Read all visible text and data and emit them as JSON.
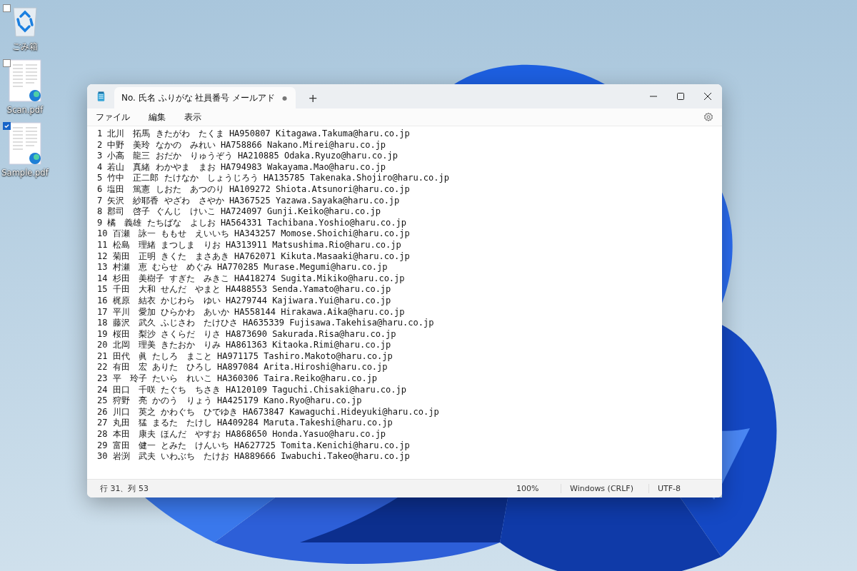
{
  "desktop_icons": [
    {
      "kind": "recycle",
      "label": "ごみ箱",
      "selected": false
    },
    {
      "kind": "pdf",
      "label": "Scan.pdf",
      "selected": false
    },
    {
      "kind": "pdf",
      "label": "Sample.pdf",
      "selected": true
    }
  ],
  "window": {
    "tabs": [
      {
        "label": "No. 氏名 ふりがな 社員番号 メールアド",
        "unsaved_mark": "●",
        "selected": true
      }
    ],
    "new_tab": "+",
    "menu": [
      "ファイル",
      "編集",
      "表示"
    ],
    "lines": [
      "1 北川　拓馬 きたがわ　たくま HA950807 Kitagawa.Takuma@haru.co.jp",
      "2 中野　美玲 なかの　みれい HA758866 Nakano.Mirei@haru.co.jp",
      "3 小高　龍三 おだか　りゅうぞう HA210885 Odaka.Ryuzo@haru.co.jp",
      "4 若山　真緒 わかやま　まお HA794983 Wakayama.Mao@haru.co.jp",
      "5 竹中　正二郎 たけなか　しょうじろう HA135785 Takenaka.Shojiro@haru.co.jp",
      "6 塩田　篤憲 しおた　あつのり HA109272 Shiota.Atsunori@haru.co.jp",
      "7 矢沢　紗耶香 やざわ　さやか HA367525 Yazawa.Sayaka@haru.co.jp",
      "8 郡司　啓子 ぐんじ　けいこ HA724097 Gunji.Keiko@haru.co.jp",
      "9 橘　義雄 たちばな　よしお HA564331 Tachibana.Yoshio@haru.co.jp",
      "10 百瀬　詠一 ももせ　えいいち HA343257 Momose.Shoichi@haru.co.jp",
      "11 松島　理緒 まつしま　りお HA313911 Matsushima.Rio@haru.co.jp",
      "12 菊田　正明 きくた　まさあき HA762071 Kikuta.Masaaki@haru.co.jp",
      "13 村瀬　恵 むらせ　めぐみ HA770285 Murase.Megumi@haru.co.jp",
      "14 杉田　美樹子 すぎた　みきこ HA418274 Sugita.Mikiko@haru.co.jp",
      "15 千田　大和 せんだ　やまと HA488553 Senda.Yamato@haru.co.jp",
      "16 梶原　結衣 かじわら　ゆい HA279744 Kajiwara.Yui@haru.co.jp",
      "17 平川　愛加 ひらかわ　あいか HA558144 Hirakawa.Aika@haru.co.jp",
      "18 藤沢　武久 ふじさわ　たけひさ HA635339 Fujisawa.Takehisa@haru.co.jp",
      "19 桜田　梨沙 さくらだ　りさ HA873690 Sakurada.Risa@haru.co.jp",
      "20 北岡　理美 きたおか　りみ HA861363 Kitaoka.Rimi@haru.co.jp",
      "21 田代　眞 たしろ　まこと HA971175 Tashiro.Makoto@haru.co.jp",
      "22 有田　宏 ありた　ひろし HA897084 Arita.Hiroshi@haru.co.jp",
      "23 平　玲子 たいら　れいこ HA360306 Taira.Reiko@haru.co.jp",
      "24 田口　千咲 たぐち　ちさき HA120109 Taguchi.Chisaki@haru.co.jp",
      "25 狩野　亮 かのう　りょう HA425179 Kano.Ryo@haru.co.jp",
      "26 川口　英之 かわぐち　ひでゆき HA673847 Kawaguchi.Hideyuki@haru.co.jp",
      "27 丸田　猛 まるた　たけし HA409284 Maruta.Takeshi@haru.co.jp",
      "28 本田　康夫 ほんだ　やすお HA868650 Honda.Yasuo@haru.co.jp",
      "29 富田　健一 とみた　けんいち HA627725 Tomita.Kenichi@haru.co.jp",
      "30 岩渕　武夫 いわぶち　たけお HA889666 Iwabuchi.Takeo@haru.co.jp"
    ],
    "status_bar": {
      "position": "行 31、列 53",
      "zoom": "100%",
      "line_ending": "Windows (CRLF)",
      "encoding": "UTF-8"
    }
  }
}
